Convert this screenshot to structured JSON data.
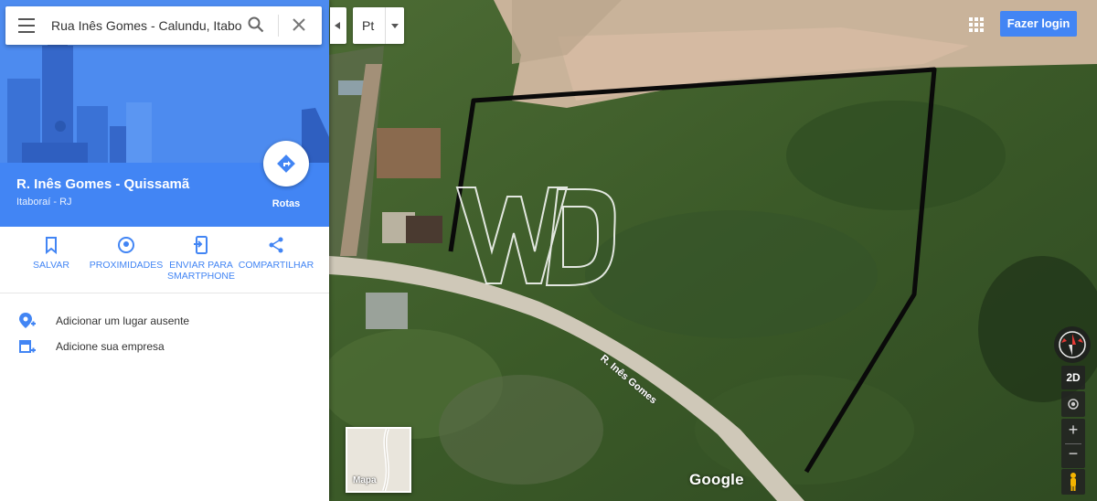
{
  "search": {
    "value": "Rua Inês Gomes - Calundu, Itabor"
  },
  "collapse": {
    "icon": "chevron-left-icon"
  },
  "language": {
    "selected": "Pt"
  },
  "place": {
    "title": "R. Inês Gomes - Quissamã",
    "subtitle": "Itaboraí - RJ",
    "routes_label": "Rotas"
  },
  "actions": [
    {
      "label": "SALVAR",
      "icon": "bookmark-icon"
    },
    {
      "label": "PROXIMIDADES",
      "icon": "nearby-icon"
    },
    {
      "label": "ENVIAR PARA SMARTPHONE",
      "icon": "send-to-phone-icon"
    },
    {
      "label": "COMPARTILHAR",
      "icon": "share-icon"
    }
  ],
  "list": [
    {
      "label": "Adicionar um lugar ausente",
      "icon": "add-place-icon"
    },
    {
      "label": "Adicione sua empresa",
      "icon": "add-business-icon"
    }
  ],
  "map": {
    "login_label": "Fazer login",
    "view_toggle": "2D",
    "zoom_in": "+",
    "zoom_out": "−",
    "thumbnail_label": "Mapa",
    "logo": "Google",
    "road_label": "R. Inês Gomes"
  },
  "colors": {
    "accent": "#4285f4",
    "panel": "#ffffff"
  }
}
